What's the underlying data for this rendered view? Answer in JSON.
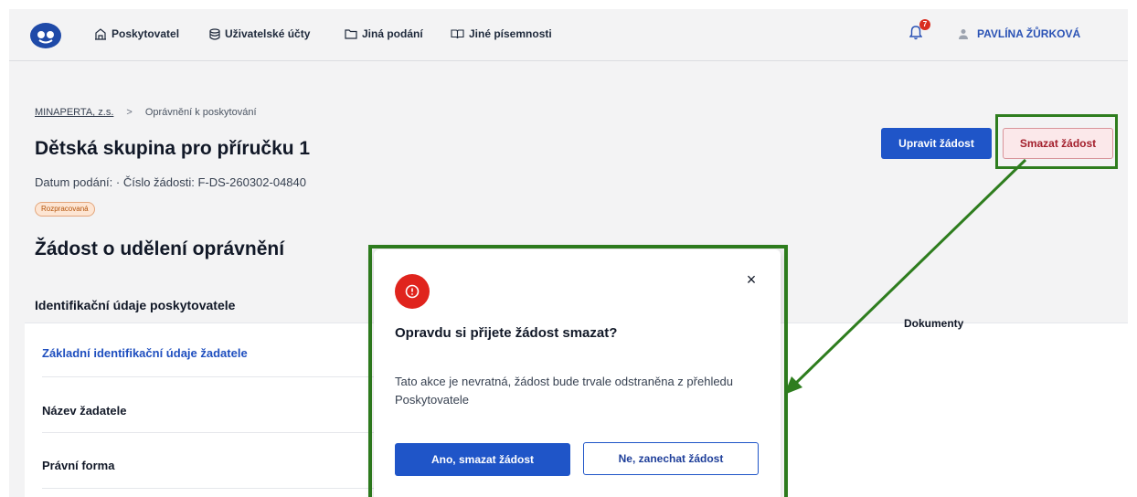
{
  "header": {
    "nav": [
      {
        "label": "Poskytovatel",
        "icon": "building-icon"
      },
      {
        "label": "Uživatelské účty",
        "icon": "database-icon"
      },
      {
        "label": "Jiná podání",
        "icon": "folder-icon"
      },
      {
        "label": "Jiné písemnosti",
        "icon": "book-icon"
      }
    ],
    "notification_count": "7",
    "user_name": "PAVLÍNA ŽŮRKOVÁ"
  },
  "breadcrumb": {
    "root": "MINAPERTA, z.s.",
    "separator": ">",
    "current": "Oprávnění k poskytování"
  },
  "page": {
    "title": "Dětská skupina pro příručku 1",
    "meta": "Datum podání:  · Číslo žádosti: F-DS-260302-04840",
    "status_badge": "Rozpracovaná",
    "edit_button": "Upravit žádost",
    "delete_button": "Smazat žádost",
    "section_title": "Žádost o udělení oprávnění",
    "subsection_title": "Identifikační údaje poskytovatele",
    "documents_column": "Dokumenty",
    "rows": [
      {
        "label": "Základní identifikační údaje žadatele"
      },
      {
        "label": "Název žadatele"
      },
      {
        "label": "Právní forma"
      }
    ]
  },
  "modal": {
    "title": "Opravdu si přijete žádost smazat?",
    "body": "Tato akce je nevratná, žádost bude trvale odstraněna z přehledu Poskytovatele",
    "confirm_button": "Ano, smazat žádost",
    "cancel_button": "Ne, zanechat žádost",
    "close": "×"
  },
  "colors": {
    "primary": "#1f55c8",
    "danger": "#e0241d",
    "highlight": "#2e7d1e"
  }
}
